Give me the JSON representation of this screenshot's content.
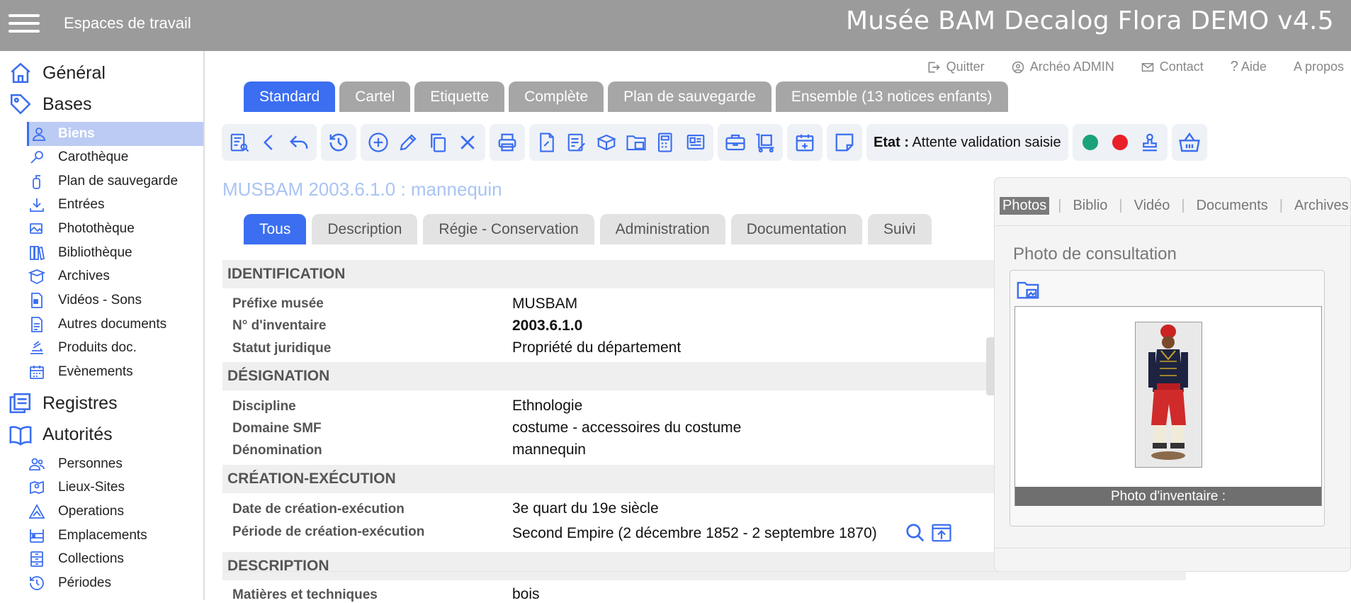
{
  "app": {
    "title": "Musée BAM Decalog Flora DEMO v4.5",
    "workspaces": "Espaces de travail"
  },
  "colors": {
    "accent": "#3b6ef0",
    "topbar": "#9b9b9b",
    "tab_inactive": "#a6a6a6",
    "active_item": "#bccbf3",
    "status_green": "#1aa37a",
    "status_red": "#e8202a"
  },
  "sidebar": {
    "general": "Général",
    "bases": "Bases",
    "bases_items": [
      "Biens",
      "Carothèque",
      "Plan de sauvegarde",
      "Entrées",
      "Photothèque",
      "Bibliothèque",
      "Archives",
      "Vidéos - Sons",
      "Autres documents",
      "Produits doc.",
      "Evènements"
    ],
    "registres": "Registres",
    "autorites": "Autorités",
    "autorites_items": [
      "Personnes",
      "Lieux-Sites",
      "Operations",
      "Emplacements",
      "Collections",
      "Périodes"
    ]
  },
  "toplinks": {
    "quit": "Quitter",
    "user": "Archéo ADMIN",
    "contact": "Contact",
    "help": "Aide",
    "about": "A propos"
  },
  "view_tabs": [
    "Standard",
    "Cartel",
    "Etiquette",
    "Complète",
    "Plan de sauvegarde",
    "Ensemble (13 notices enfants)"
  ],
  "toolbar": {
    "etat_label": "Etat :",
    "etat_value": "Attente validation saisie"
  },
  "record_title": "MUSBAM 2003.6.1.0 : mannequin",
  "section_tabs": [
    "Tous",
    "Description",
    "Régie - Conservation",
    "Administration",
    "Documentation",
    "Suivi"
  ],
  "sections": {
    "identification": "IDENTIFICATION",
    "designation": "DÉSIGNATION",
    "creation": "CRÉATION-EXÉCUTION",
    "description": "DESCRIPTION"
  },
  "fields": {
    "prefixe": {
      "label": "Préfixe musée",
      "value": "MUSBAM"
    },
    "inventaire": {
      "label": "N° d'inventaire",
      "value": "2003.6.1.0"
    },
    "statut": {
      "label": "Statut juridique",
      "value": "Propriété du département"
    },
    "discipline": {
      "label": "Discipline",
      "value": "Ethnologie"
    },
    "domaine": {
      "label": "Domaine SMF",
      "value": "costume - accessoires du costume"
    },
    "denomination": {
      "label": "Dénomination",
      "value": "mannequin"
    },
    "date": {
      "label": "Date de création-exécution",
      "value": "3e quart du 19e siècle"
    },
    "periode": {
      "label": "Période de création-exécution",
      "value": "Second Empire (2 décembre 1852 - 2 septembre 1870)"
    },
    "matieres": {
      "label": "Matières et techniques",
      "value": "bois"
    }
  },
  "media": {
    "tabs": [
      "Photos",
      "Biblio",
      "Vidéo",
      "Documents",
      "Archives"
    ],
    "title": "Photo de consultation",
    "caption": "Photo d'inventaire :"
  }
}
